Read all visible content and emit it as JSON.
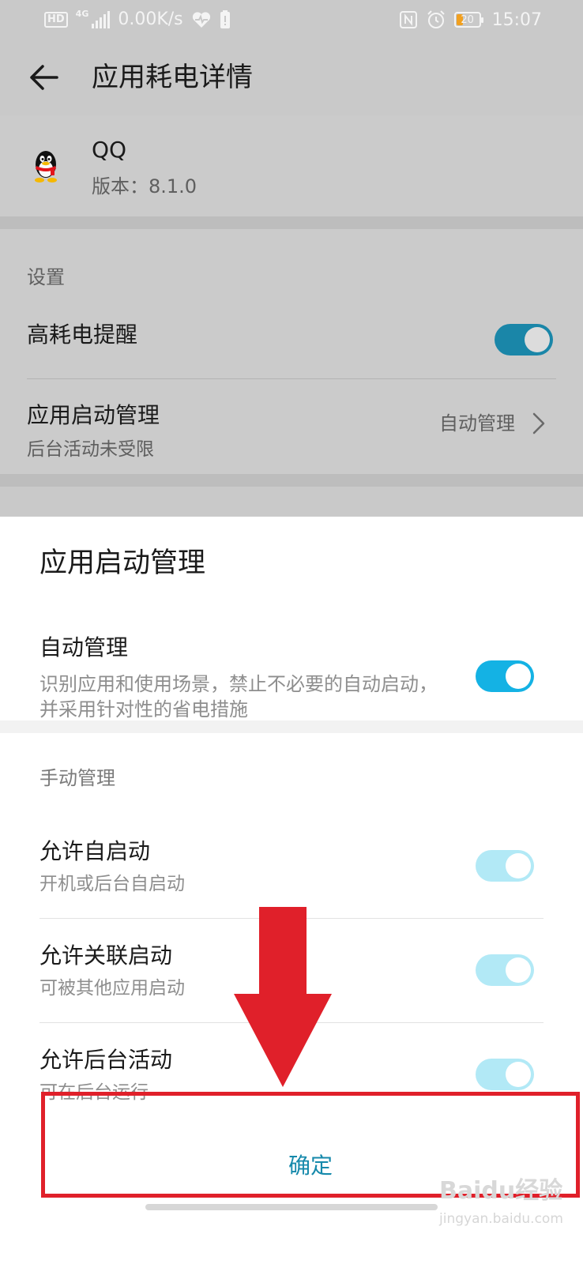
{
  "status_bar": {
    "network_badge": "HD",
    "network_gen": "4G",
    "speed": "0.00K/s",
    "battery": "20",
    "time": "15:07",
    "icons": [
      "hd-icon",
      "signal-icon",
      "heart-rate-icon",
      "alert-icon",
      "nfc-icon",
      "alarm-icon",
      "battery-icon"
    ]
  },
  "header": {
    "title": "应用耗电详情",
    "back_icon": "back-arrow-icon"
  },
  "app": {
    "name": "QQ",
    "version": "版本：8.1.0",
    "icon": "qq-penguin-icon"
  },
  "settings": {
    "section_label": "设置",
    "high_power_alert": {
      "label": "高耗电提醒",
      "enabled": true
    },
    "app_launch": {
      "label": "应用启动管理",
      "sublabel": "后台活动未受限",
      "value": "自动管理"
    }
  },
  "sheet": {
    "title": "应用启动管理",
    "auto_manage": {
      "label": "自动管理",
      "description": "识别应用和使用场景，禁止不必要的自动启动，并采用针对性的省电措施",
      "enabled": true
    },
    "manual_label": "手动管理",
    "manual_items": [
      {
        "label": "允许自启动",
        "sub": "开机或后台自启动",
        "enabled": true
      },
      {
        "label": "允许关联启动",
        "sub": "可被其他应用启动",
        "enabled": true
      },
      {
        "label": "允许后台活动",
        "sub": "可在后台运行",
        "enabled": true
      }
    ],
    "confirm_label": "确定"
  },
  "watermark": {
    "brand": "Baidu经验",
    "url": "jingyan.baidu.com"
  },
  "colors": {
    "accent": "#14b2e4",
    "accent_disabled": "#b2e9f6",
    "confirm_text": "#1589ab",
    "annotation_red": "#e0202a"
  }
}
